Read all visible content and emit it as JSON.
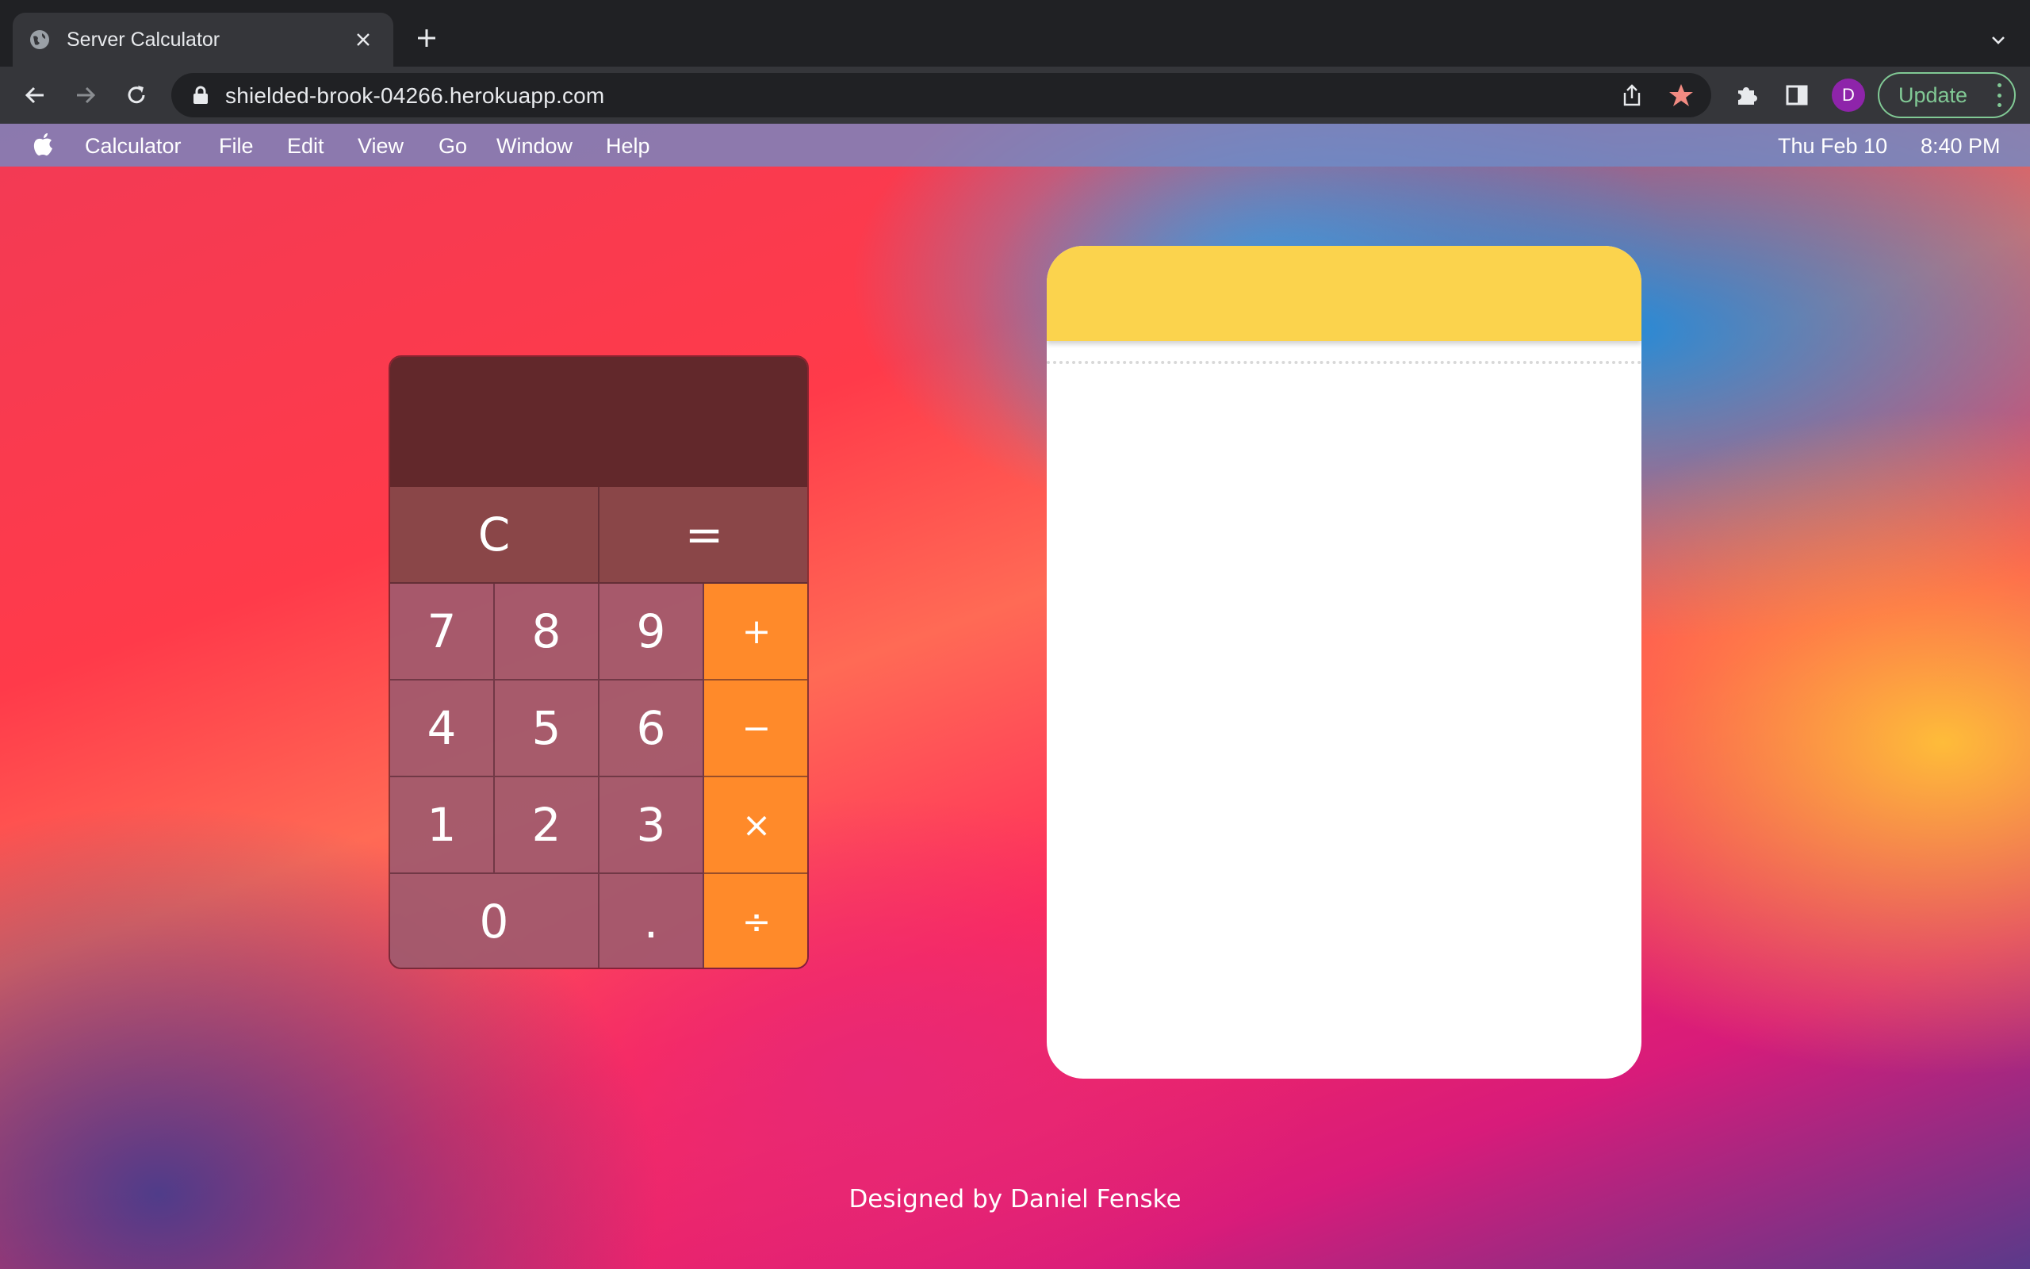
{
  "browser": {
    "tab_title": "Server Calculator",
    "url": "shielded-brook-04266.herokuapp.com",
    "profile_initial": "D",
    "update_label": "Update"
  },
  "menubar": {
    "app_name": "Calculator",
    "items": [
      "File",
      "Edit",
      "View",
      "Go",
      "Window",
      "Help"
    ],
    "date": "Thu Feb 10",
    "time": "8:40 PM"
  },
  "calculator": {
    "display": "",
    "keys": {
      "clear": "C",
      "equals": "=",
      "seven": "7",
      "eight": "8",
      "nine": "9",
      "four": "4",
      "five": "5",
      "six": "6",
      "one": "1",
      "two": "2",
      "three": "3",
      "zero": "0",
      "decimal": ".",
      "plus": "+",
      "minus": "−",
      "multiply": "×",
      "divide": "÷"
    }
  },
  "history": {
    "entries": []
  },
  "footer": {
    "credit": "Designed by Daniel Fenske"
  },
  "colors": {
    "operator_key": "#ff8a2a",
    "display_bg": "#62282b",
    "notepad_header": "#fbd34d",
    "update_accent": "#81c995",
    "avatar": "#8e24aa"
  }
}
